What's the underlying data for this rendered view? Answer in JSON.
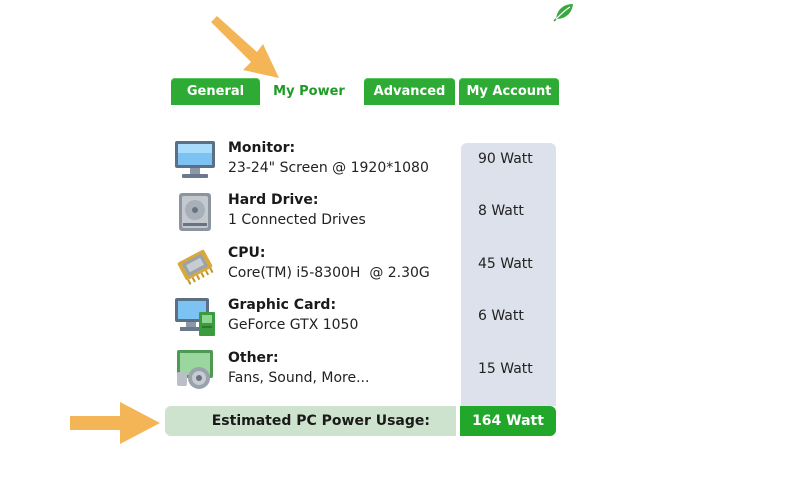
{
  "tabs": [
    {
      "label": "General"
    },
    {
      "label": "My Power"
    },
    {
      "label": "Advanced"
    },
    {
      "label": "My Account"
    }
  ],
  "active_tab": "My Power",
  "components": [
    {
      "icon": "monitor-icon",
      "title": "Monitor:",
      "detail": "23-24\" Screen @ 1920*1080",
      "watt": "90 Watt"
    },
    {
      "icon": "hard-drive-icon",
      "title": "Hard Drive:",
      "detail": "1 Connected Drives",
      "watt": "8 Watt"
    },
    {
      "icon": "cpu-icon",
      "title": "CPU:",
      "detail": "Core(TM) i5-8300H  @ 2.30G",
      "watt": "45 Watt"
    },
    {
      "icon": "graphic-card-icon",
      "title": "Graphic Card:",
      "detail": "GeForce GTX 1050",
      "watt": "6 Watt"
    },
    {
      "icon": "speaker-icon",
      "title": "Other:",
      "detail": "Fans, Sound, More...",
      "watt": "15 Watt"
    }
  ],
  "total": {
    "label": "Estimated PC Power Usage:",
    "value": "164 Watt"
  },
  "colors": {
    "brand_green": "#2eab34",
    "accent_arrow": "#f4b556",
    "watt_column": "#dde1eb",
    "total_bar": "#cde3cd"
  }
}
